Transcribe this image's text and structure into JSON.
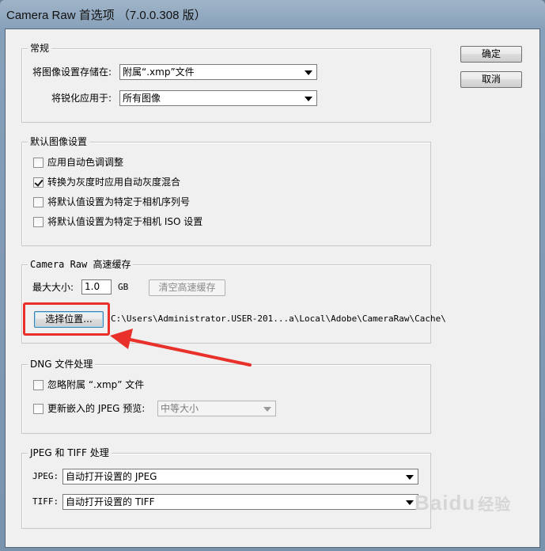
{
  "window": {
    "title": "Camera Raw 首选项 （7.0.0.308 版）"
  },
  "buttons": {
    "ok": "确定",
    "cancel": "取消"
  },
  "general": {
    "legend": "常规",
    "save_label": "将图像设置存储在:",
    "save_value": "附属“.xmp”文件",
    "sharpen_label": "将锐化应用于:",
    "sharpen_value": "所有图像"
  },
  "defaults": {
    "legend": "默认图像设置",
    "items": [
      {
        "label": "应用自动色调调整",
        "checked": false
      },
      {
        "label": "转换为灰度时应用自动灰度混合",
        "checked": true
      },
      {
        "label": "将默认值设置为特定于相机序列号",
        "checked": false
      },
      {
        "label": "将默认值设置为特定于相机 ISO 设置",
        "checked": false
      }
    ]
  },
  "cache": {
    "legend": "Camera Raw 高速缓存",
    "max_size_label": "最大大小:",
    "max_size_value": "1.0",
    "unit": "GB",
    "purge_button": "清空高速缓存",
    "select_button": "选择位置...",
    "path": "C:\\Users\\Administrator.USER-201...a\\Local\\Adobe\\CameraRaw\\Cache\\"
  },
  "dng": {
    "legend": "DNG 文件处理",
    "ignore_label": "忽略附属 “.xmp” 文件",
    "ignore_checked": false,
    "update_label": "更新嵌入的 JPEG 预览:",
    "update_checked": false,
    "update_value": "中等大小"
  },
  "jpeg_tiff": {
    "legend": "JPEG 和 TIFF 处理",
    "jpeg_label": "JPEG:",
    "jpeg_value": "自动打开设置的 JPEG",
    "tiff_label": "TIFF:",
    "tiff_value": "自动打开设置的 TIFF"
  },
  "watermark": {
    "text": "Baidu",
    "sub": "经验"
  },
  "colors": {
    "annotation": "#e8312b",
    "titlebar": "#9fb4c8"
  }
}
